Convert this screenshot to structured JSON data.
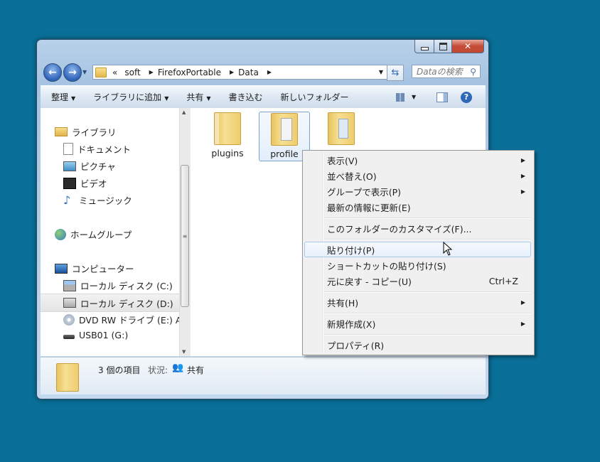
{
  "window": {
    "caption_buttons": [
      "minimize-icon",
      "maximize-icon",
      "close-icon"
    ]
  },
  "address": {
    "chevron": "«",
    "crumbs": [
      "soft",
      "FirefoxPortable",
      "Data"
    ],
    "search_placeholder": "Dataの検索"
  },
  "toolbar": {
    "organize": "整理",
    "add_to_library": "ライブラリに追加",
    "share": "共有",
    "burn": "書き込む",
    "new_folder": "新しいフォルダー"
  },
  "sidebar": {
    "libraries": "ライブラリ",
    "documents": "ドキュメント",
    "pictures": "ピクチャ",
    "videos": "ビデオ",
    "music": "ミュージック",
    "homegroup": "ホームグループ",
    "computer": "コンピューター",
    "drive_c": "ローカル ディスク (C:)",
    "drive_d": "ローカル ディスク (D:)",
    "drive_e": "DVD RW ドライブ (E:) Al",
    "drive_g": "USB01 (G:)"
  },
  "files": [
    {
      "name": "plugins"
    },
    {
      "name": "profile"
    },
    {
      "name": ""
    }
  ],
  "status": {
    "count": "3 個の項目",
    "state_label": "状況:",
    "state_value": "共有"
  },
  "context_menu": {
    "view": "表示(V)",
    "sort": "並べ替え(O)",
    "group": "グループで表示(P)",
    "refresh": "最新の情報に更新(E)",
    "customize": "このフォルダーのカスタマイズ(F)...",
    "paste": "貼り付け(P)",
    "paste_shortcut": "ショートカットの貼り付け(S)",
    "undo": "元に戻す - コピー(U)",
    "undo_shortcut": "Ctrl+Z",
    "share": "共有(H)",
    "new": "新規作成(X)",
    "properties": "プロパティ(R)"
  },
  "colors": {
    "desktop": "#0a7099",
    "highlight": "#a8caf0"
  }
}
